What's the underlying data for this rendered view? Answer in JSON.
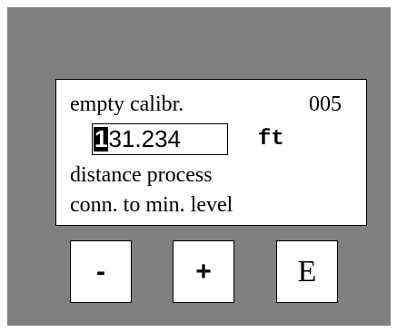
{
  "display": {
    "title": "empty calibr.",
    "code": "005",
    "value_cursor_digit": "1",
    "value_rest": "31.234",
    "unit": "ft",
    "line3": "distance process",
    "line4": "conn. to min. level"
  },
  "keys": {
    "minus": "-",
    "plus": "+",
    "enter": "E"
  }
}
